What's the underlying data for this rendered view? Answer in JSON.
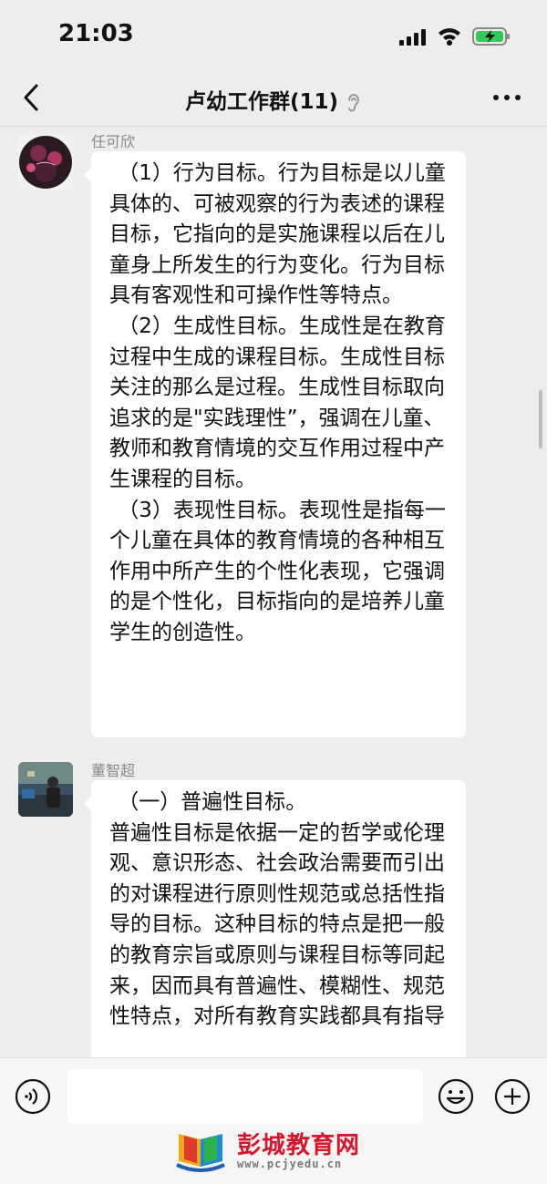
{
  "status": {
    "time": "21:03"
  },
  "nav": {
    "title": "卢幼工作群(11)"
  },
  "messages": [
    {
      "sender": "任可欣",
      "paragraphs": [
        "（1）行为目标。行为目标是以儿童具体的、可被观察的行为表述的课程目标，它指向的是实施课程以后在儿童身上所发生的行为变化。行为目标具有客观性和可操作性等特点。",
        "（2）生成性目标。生成性是在教育过程中生成的课程目标。生成性目标关注的那么是过程。生成性目标取向追求的是\"实践理性”，强调在儿童、教师和教育情境的交互作用过程中产生课程的目标。",
        "（3）表现性目标。表现性是指每一个儿童在具体的教育情境的各种相互作用中所产生的个性化表现，它强调的是个性化，目标指向的是培养儿童学生的创造性。"
      ]
    },
    {
      "sender": "董智超",
      "paragraphs": [
        "（一）普遍性目标。",
        "普遍性目标是依据一定的哲学或伦理观、意识形态、社会政治需要而引出的对课程进行原则性规范或总括性指导的目标。这种目标的特点是把一般的教育宗旨或原则与课程目标等同起来，因而具有普遍性、模糊性、规范性特点，对所有教育实践都具有指导"
      ]
    }
  ],
  "watermark": {
    "name": "彭城教育网",
    "url": "www.pcjyedu.cn"
  },
  "colors": {
    "background": "#ededed",
    "bubble": "#ffffff",
    "watermark_red": "#d6142b"
  }
}
